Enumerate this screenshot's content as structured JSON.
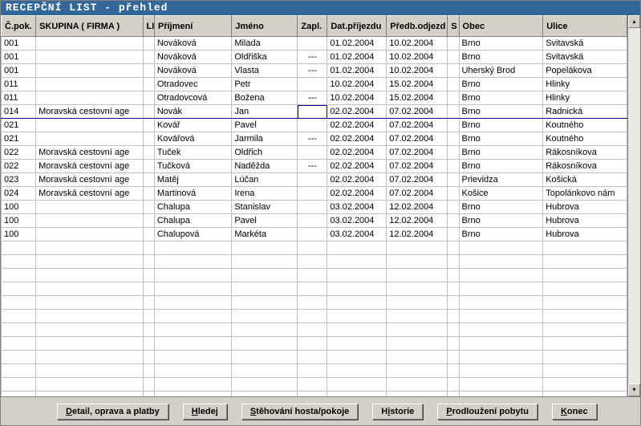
{
  "title": "RECEPČNÍ LIST - přehled",
  "columns": {
    "cpok": "Č.pok.",
    "skupina": "SKUPINA ( FIRMA )",
    "li": "LI",
    "prijmeni": "Příjmení",
    "jmeno": "Jméno",
    "zapl": "Zapl.",
    "datprijezdu": "Dat.příjezdu",
    "predbodjezd": "Předb.odjezd",
    "s": "S",
    "obec": "Obec",
    "ulice": "Ulice"
  },
  "rows": [
    {
      "cpok": "001",
      "skupina": "",
      "li": "",
      "prijmeni": "Nováková",
      "jmeno": "Milada",
      "zapl": "",
      "datp": "01.02.2004",
      "pred": "10.02.2004",
      "s": "",
      "obec": "Brno",
      "ulice": "Svitavská"
    },
    {
      "cpok": "001",
      "skupina": "",
      "li": "",
      "prijmeni": "Nováková",
      "jmeno": "Oldřiška",
      "zapl": "---",
      "datp": "01.02.2004",
      "pred": "10.02.2004",
      "s": "",
      "obec": "Brno",
      "ulice": "Svitavská"
    },
    {
      "cpok": "001",
      "skupina": "",
      "li": "",
      "prijmeni": "Nováková",
      "jmeno": "Vlasta",
      "zapl": "---",
      "datp": "01.02.2004",
      "pred": "10.02.2004",
      "s": "",
      "obec": "Uherský Brod",
      "ulice": "Popelákova"
    },
    {
      "cpok": "011",
      "skupina": "",
      "li": "",
      "prijmeni": "Otradovec",
      "jmeno": "Petr",
      "zapl": "",
      "datp": "10.02.2004",
      "pred": "15.02.2004",
      "s": "",
      "obec": "Brno",
      "ulice": "Hlinky"
    },
    {
      "cpok": "011",
      "skupina": "",
      "li": "",
      "prijmeni": "Otradovcová",
      "jmeno": "Božena",
      "zapl": "---",
      "datp": "10.02.2004",
      "pred": "15.02.2004",
      "s": "",
      "obec": "Brno",
      "ulice": "Hlinky"
    },
    {
      "cpok": "014",
      "skupina": "Moravská cestovní age",
      "li": "",
      "prijmeni": "Novák",
      "jmeno": "Jan",
      "zapl": "",
      "datp": "02.02.2004",
      "pred": "07.02.2004",
      "s": "",
      "obec": "Brno",
      "ulice": "Radnická",
      "selected": true
    },
    {
      "cpok": "021",
      "skupina": "",
      "li": "",
      "prijmeni": "Kovář",
      "jmeno": "Pavel",
      "zapl": "",
      "datp": "02.02.2004",
      "pred": "07.02.2004",
      "s": "",
      "obec": "Brno",
      "ulice": "Koutného"
    },
    {
      "cpok": "021",
      "skupina": "",
      "li": "",
      "prijmeni": "Kovářová",
      "jmeno": "Jarmila",
      "zapl": "---",
      "datp": "02.02.2004",
      "pred": "07.02.2004",
      "s": "",
      "obec": "Brno",
      "ulice": "Koutného"
    },
    {
      "cpok": "022",
      "skupina": "Moravská cestovní age",
      "li": "",
      "prijmeni": "Tuček",
      "jmeno": "Oldřich",
      "zapl": "",
      "datp": "02.02.2004",
      "pred": "07.02.2004",
      "s": "",
      "obec": "Brno",
      "ulice": "Rákosníkova"
    },
    {
      "cpok": "022",
      "skupina": "Moravská cestovní age",
      "li": "",
      "prijmeni": "Tučková",
      "jmeno": "Naděžda",
      "zapl": "---",
      "datp": "02.02.2004",
      "pred": "07.02.2004",
      "s": "",
      "obec": "Brno",
      "ulice": "Rákosníkova"
    },
    {
      "cpok": "023",
      "skupina": "Moravská cestovní age",
      "li": "",
      "prijmeni": "Matěj",
      "jmeno": "Lúčan",
      "zapl": "",
      "datp": "02.02.2004",
      "pred": "07.02.2004",
      "s": "",
      "obec": "Prievidza",
      "ulice": "Košická"
    },
    {
      "cpok": "024",
      "skupina": "Moravská cestovní age",
      "li": "",
      "prijmeni": "Martinová",
      "jmeno": "Irena",
      "zapl": "",
      "datp": "02.02.2004",
      "pred": "07.02.2004",
      "s": "",
      "obec": "Košice",
      "ulice": "Topolánkovo nám"
    },
    {
      "cpok": "100",
      "skupina": "",
      "li": "",
      "prijmeni": "Chalupa",
      "jmeno": "Stanislav",
      "zapl": "",
      "datp": "03.02.2004",
      "pred": "12.02.2004",
      "s": "",
      "obec": "Brno",
      "ulice": "Hubrova"
    },
    {
      "cpok": "100",
      "skupina": "",
      "li": "",
      "prijmeni": "Chalupa",
      "jmeno": "Pavel",
      "zapl": "",
      "datp": "03.02.2004",
      "pred": "12.02.2004",
      "s": "",
      "obec": "Brno",
      "ulice": "Hubrova"
    },
    {
      "cpok": "100",
      "skupina": "",
      "li": "",
      "prijmeni": "Chalupová",
      "jmeno": "Markéta",
      "zapl": "",
      "datp": "03.02.2004",
      "pred": "12.02.2004",
      "s": "",
      "obec": "Brno",
      "ulice": "Hubrova"
    }
  ],
  "empty_row_count": 12,
  "buttons": {
    "detail": {
      "pre": "",
      "u": "D",
      "post": "etail, oprava a platby"
    },
    "hledej": {
      "pre": "",
      "u": "H",
      "post": "ledej"
    },
    "stehovani": {
      "pre": "",
      "u": "S",
      "post": "těhování hosta/pokoje"
    },
    "historie": {
      "pre": "H",
      "u": "i",
      "post": "storie"
    },
    "prodlouzeni": {
      "pre": "",
      "u": "P",
      "post": "rodloužení pobytu"
    },
    "konec": {
      "pre": "",
      "u": "K",
      "post": "onec"
    }
  }
}
